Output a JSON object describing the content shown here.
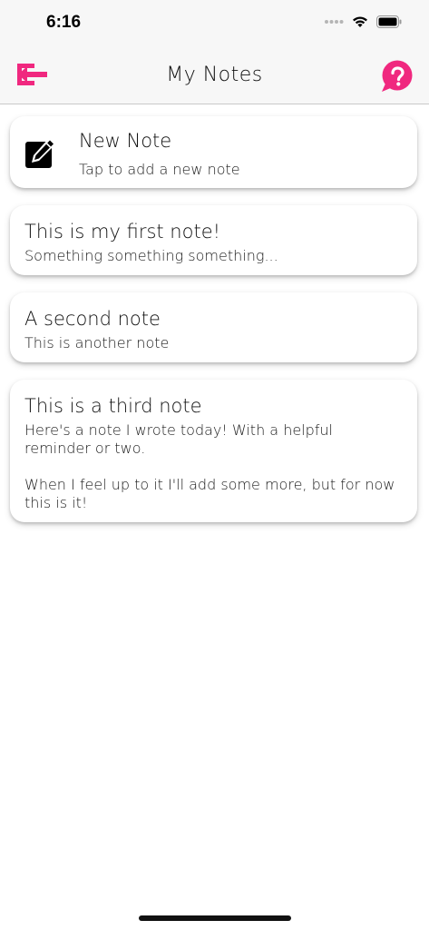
{
  "status_bar": {
    "time": "6:16"
  },
  "nav": {
    "title": "My Notes"
  },
  "new_note": {
    "title": "New Note",
    "subtitle": "Tap to add a new note"
  },
  "notes": [
    {
      "title": "This is my first note!",
      "body": "Something something something..."
    },
    {
      "title": "A second note",
      "body": "This is another note"
    },
    {
      "title": "This is a third note",
      "body": "Here's a note I wrote today! With a helpful reminder or two.\n\nWhen I feel up to it I'll add some more, but for now this is it!"
    }
  ],
  "colors": {
    "accent": "#f0287f",
    "nav_background": "#f7f7f7"
  },
  "icons": {
    "back": "arrow-left-exit-icon",
    "help": "question-bubble-icon",
    "new_note": "pencil-square-icon",
    "signal": "signal-dots-icon",
    "wifi": "wifi-icon",
    "battery": "battery-icon"
  }
}
